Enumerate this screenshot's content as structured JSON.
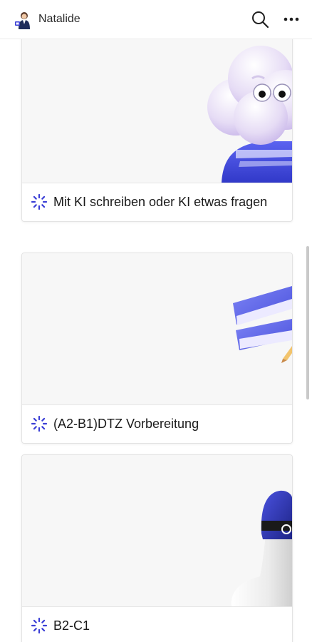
{
  "header": {
    "title": "Natalide",
    "avatar_icon": "avatar",
    "search_icon": "search-icon",
    "more_icon": "more-horizontal-icon"
  },
  "cards": [
    {
      "label": "Mit KI schreiben oder KI etwas fragen",
      "icon": "loading-spinner-icon",
      "illustration": "cloud-mascot-illustration"
    },
    {
      "label": "(A2-B1)DTZ Vorbereitung",
      "icon": "loading-spinner-icon",
      "illustration": "books-illustration"
    },
    {
      "label": "B2-C1",
      "icon": "loading-spinner-icon",
      "illustration": "bust-with-helmet-illustration"
    }
  ],
  "colors": {
    "accent": "#3b3fd6",
    "card_bg": "#f7f7f7",
    "border": "#e3e3e3"
  }
}
